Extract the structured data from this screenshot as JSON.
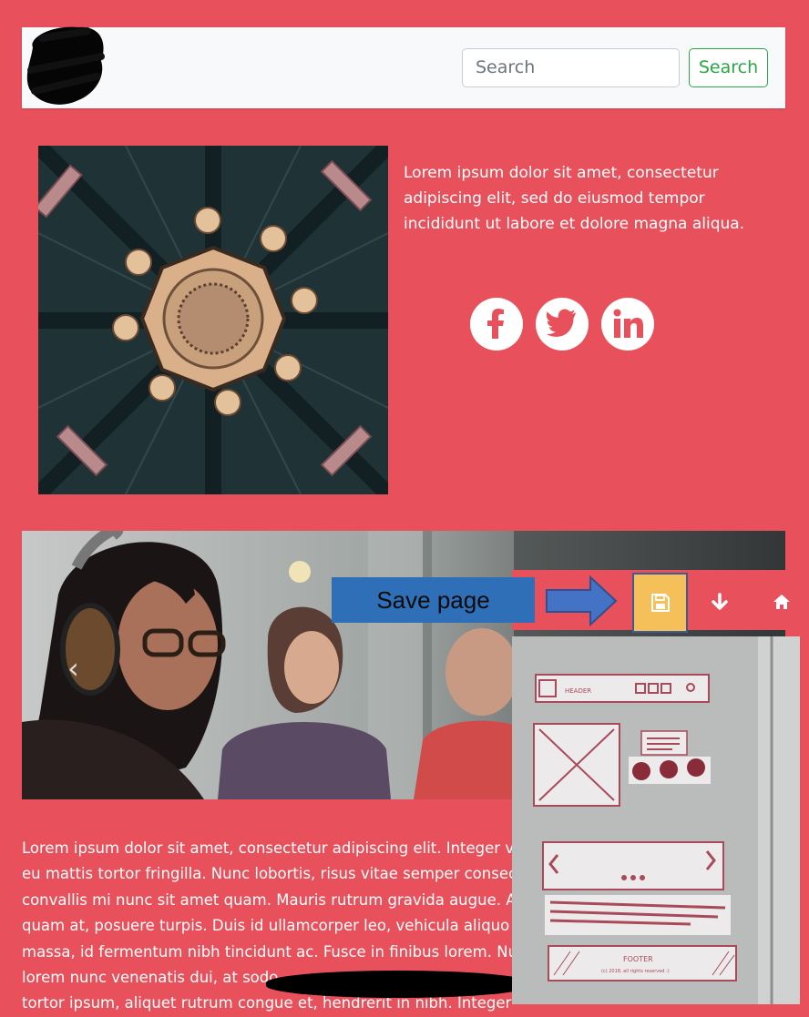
{
  "navbar": {
    "search_placeholder": "Search",
    "search_button": "Search"
  },
  "intro": {
    "text": "Lorem ipsum dolor sit amet, consectetur adipiscing elit, sed do eiusmod tempor incididunt ut labore et dolore magna aliqua."
  },
  "social": [
    "facebook-icon",
    "twitter-icon",
    "linkedin-icon"
  ],
  "carousel": {
    "prev_glyph": "‹"
  },
  "body_lines": [
    "Lorem ipsum dolor sit amet, consectetur adipiscing elit. Integer ve",
    "eu mattis tortor fringilla. Nunc lobortis, risus vitae semper consec",
    "convallis mi nunc sit amet quam. Mauris rutrum gravida augue. A",
    "quam at, posuere turpis. Duis id ullamcorper leo, vehicula aliquo",
    "massa, id fermentum nibh tincidunt ac. Fusce in finibus lorem. Nu",
    "lorem nunc venenatis dui, at sodo",
    "tortor ipsum, aliquet rutrum congue et, hendrerit in nibh. Integer"
  ],
  "annotation": {
    "label": "Save page"
  },
  "toolbar": {
    "icons": [
      "save-icon",
      "arrow-down-icon",
      "home-icon"
    ]
  },
  "wireframe": {
    "header_label": "HEADER",
    "footer_label": "FOOTER",
    "footer_note": "(c) 2018, all rights reserved :)"
  },
  "colors": {
    "page_background": "#e8505b",
    "search_button": "#28a745",
    "annotation_box": "#2e6fb8",
    "save_button": "#f5c05a"
  }
}
